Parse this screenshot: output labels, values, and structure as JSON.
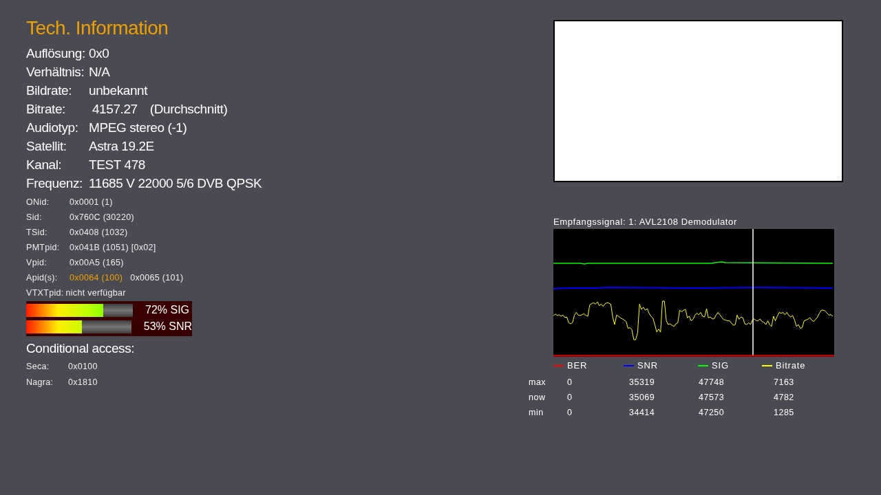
{
  "title": "Tech. Information",
  "main_rows": [
    {
      "label": "Auflösung:",
      "value": "0x0"
    },
    {
      "label": "Verhältnis:",
      "value": "N/A"
    },
    {
      "label": "Bildrate:",
      "value": "unbekannt"
    },
    {
      "label": "Bitrate:",
      "value": " 4157.27",
      "note": "(Durchschnitt)"
    },
    {
      "label": "Audiotyp:",
      "value": "MPEG stereo (-1)"
    },
    {
      "label": "Satellit:",
      "value": "Astra 19.2E"
    },
    {
      "label": "Kanal:",
      "value": "TEST 478"
    },
    {
      "label": "Frequenz:",
      "value": "11685 V 22000 5/6 DVB QPSK"
    }
  ],
  "pid_rows": [
    {
      "label": "ONid:",
      "value": "0x0001 (1)"
    },
    {
      "label": "Sid:",
      "value": "0x760C (30220)"
    },
    {
      "label": "TSid:",
      "value": "0x0408 (1032)"
    },
    {
      "label": "PMTpid:",
      "value": "0x041B (1051) [0x02]"
    },
    {
      "label": "Vpid:",
      "value": "0x00A5 (165)"
    }
  ],
  "apids": {
    "label": "Apid(s):",
    "items": [
      {
        "value": "0x0064 (100)",
        "selected": true
      },
      {
        "value": "0x0065 (101)",
        "selected": false
      }
    ]
  },
  "vtxt": {
    "label": "VTXTpid:",
    "value": "nicht verfügbar"
  },
  "meters": [
    {
      "level": 0.72,
      "reading": "72% SIG"
    },
    {
      "level": 0.53,
      "reading": "53% SNR"
    }
  ],
  "conditional_access": {
    "title": "Conditional access:",
    "rows": [
      {
        "label": "Seca:",
        "value": "0x0100"
      },
      {
        "label": "Nagra:",
        "value": "0x1810"
      }
    ]
  },
  "signal_graph": {
    "title": "Empfangssignal: 1: AVL2108 Demodulator",
    "legend": [
      {
        "name": "BER",
        "color": "#ff0000"
      },
      {
        "name": "SNR",
        "color": "#0000ff"
      },
      {
        "name": "SIG",
        "color": "#00ff00"
      },
      {
        "name": "Bitrate",
        "color": "#ffff00"
      }
    ],
    "stats": [
      {
        "label": "max",
        "values": [
          "0",
          "35319",
          "47748",
          "7163"
        ]
      },
      {
        "label": "now",
        "values": [
          "0",
          "35069",
          "47573",
          "4782"
        ]
      },
      {
        "label": "min",
        "values": [
          "0",
          "34414",
          "47250",
          "1285"
        ]
      }
    ]
  }
}
